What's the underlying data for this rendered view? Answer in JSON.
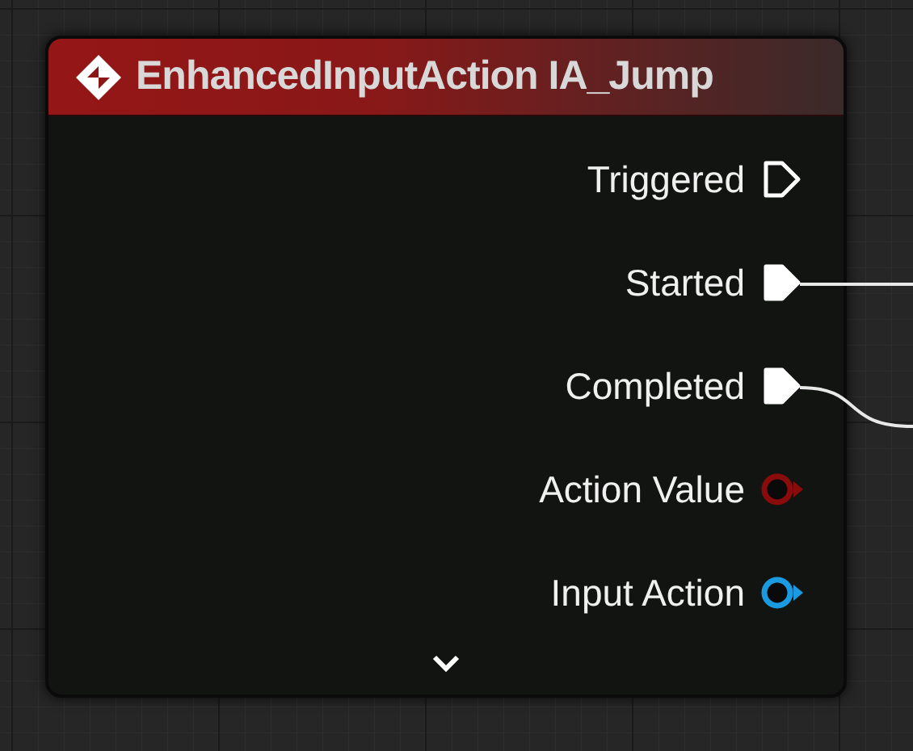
{
  "node": {
    "title": "EnhancedInputAction IA_Jump",
    "pins": [
      {
        "label": "Triggered",
        "kind": "exec",
        "connected": false
      },
      {
        "label": "Started",
        "kind": "exec",
        "connected": true
      },
      {
        "label": "Completed",
        "kind": "exec",
        "connected": true
      },
      {
        "label": "Action Value",
        "kind": "data",
        "connected": false,
        "color": "#8a0b0b"
      },
      {
        "label": "Input Action",
        "kind": "data",
        "connected": false,
        "color": "#1a9ae0"
      }
    ],
    "expanded": false
  }
}
